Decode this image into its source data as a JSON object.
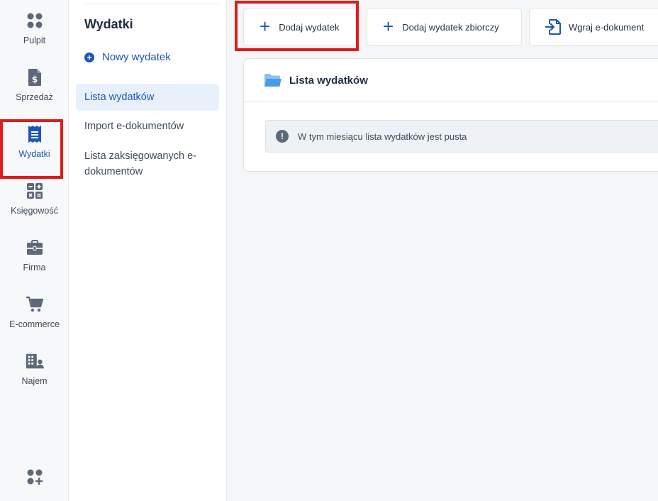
{
  "rail": {
    "items": [
      {
        "label": "Pulpit",
        "icon": "dashboard-icon"
      },
      {
        "label": "Sprzedaż",
        "icon": "invoice-dollar-icon"
      },
      {
        "label": "Wydatki",
        "icon": "receipt-icon"
      },
      {
        "label": "Księgowość",
        "icon": "calculator-icon"
      },
      {
        "label": "Firma",
        "icon": "briefcase-icon"
      },
      {
        "label": "E-commerce",
        "icon": "cart-icon"
      },
      {
        "label": "Najem",
        "icon": "building-person-icon"
      }
    ],
    "bottom_icon": "add-apps-icon"
  },
  "subnav": {
    "title": "Wydatki",
    "new_label": "Nowy wydatek",
    "items": [
      {
        "label": "Lista wydatków"
      },
      {
        "label": "Import e-dokumentów"
      },
      {
        "label": "Lista zaksięgowanych e-dokumentów"
      }
    ]
  },
  "toolbar": {
    "add_expense": "Dodaj wydatek",
    "add_collective": "Dodaj wydatek zbiorczy",
    "upload_edoc": "Wgraj e-dokument"
  },
  "list": {
    "title": "Lista wydatków",
    "empty_message": "W tym miesiącu lista wydatków jest pusta"
  },
  "colors": {
    "accent": "#1d56b8",
    "highlight": "#e01b1b",
    "active_bg": "#e8f1fb"
  }
}
